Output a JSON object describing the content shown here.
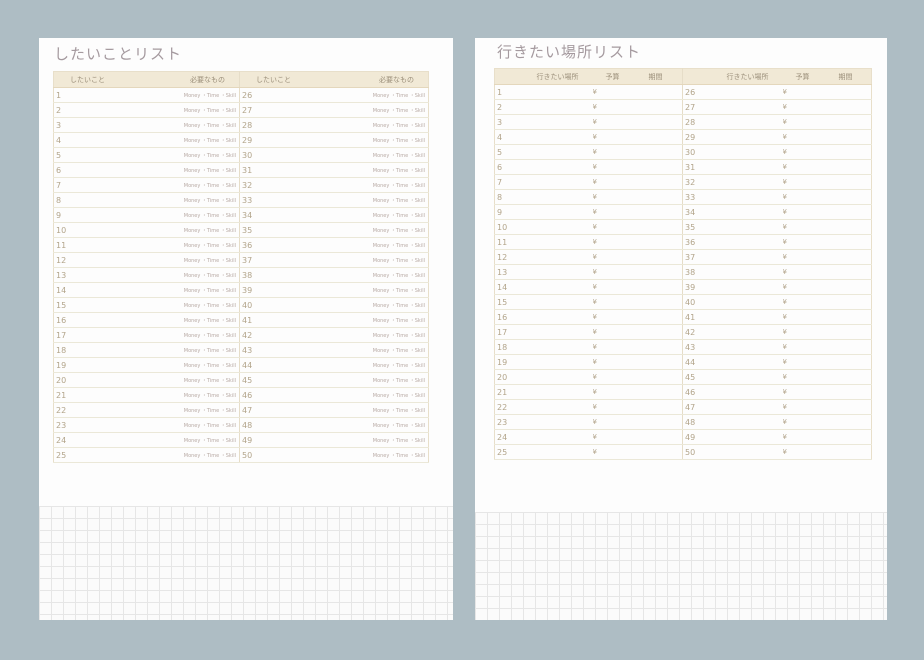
{
  "wish_list": {
    "title": "したいことリスト",
    "headers": [
      "したいこと",
      "必要なもの",
      "したいこと",
      "必要なもの"
    ],
    "needs_text": "Money ・Time ・Skill",
    "left_numbers": [
      "1",
      "2",
      "3",
      "4",
      "5",
      "6",
      "7",
      "8",
      "9",
      "10",
      "11",
      "12",
      "13",
      "14",
      "15",
      "16",
      "17",
      "18",
      "19",
      "20",
      "21",
      "22",
      "23",
      "24",
      "25"
    ],
    "right_numbers": [
      "26",
      "27",
      "28",
      "29",
      "30",
      "31",
      "32",
      "33",
      "34",
      "35",
      "36",
      "37",
      "38",
      "39",
      "40",
      "41",
      "42",
      "43",
      "44",
      "45",
      "46",
      "47",
      "48",
      "49",
      "50"
    ]
  },
  "place_list": {
    "title": "行きたい場所リスト",
    "headers": [
      "行きたい場所",
      "予算",
      "期間",
      "行きたい場所",
      "予算",
      "期間"
    ],
    "currency": "¥",
    "left_numbers": [
      "1",
      "2",
      "3",
      "4",
      "5",
      "6",
      "7",
      "8",
      "9",
      "10",
      "11",
      "12",
      "13",
      "14",
      "15",
      "16",
      "17",
      "18",
      "19",
      "20",
      "21",
      "22",
      "23",
      "24",
      "25"
    ],
    "right_numbers": [
      "26",
      "27",
      "28",
      "29",
      "30",
      "31",
      "32",
      "33",
      "34",
      "35",
      "36",
      "37",
      "38",
      "39",
      "40",
      "41",
      "42",
      "43",
      "44",
      "45",
      "46",
      "47",
      "48",
      "49",
      "50"
    ]
  },
  "colors": {
    "background": "#aebdc4",
    "paper": "#fdfdfd",
    "header_fill": "#f1e9d6",
    "title_text": "#a59a9f"
  }
}
